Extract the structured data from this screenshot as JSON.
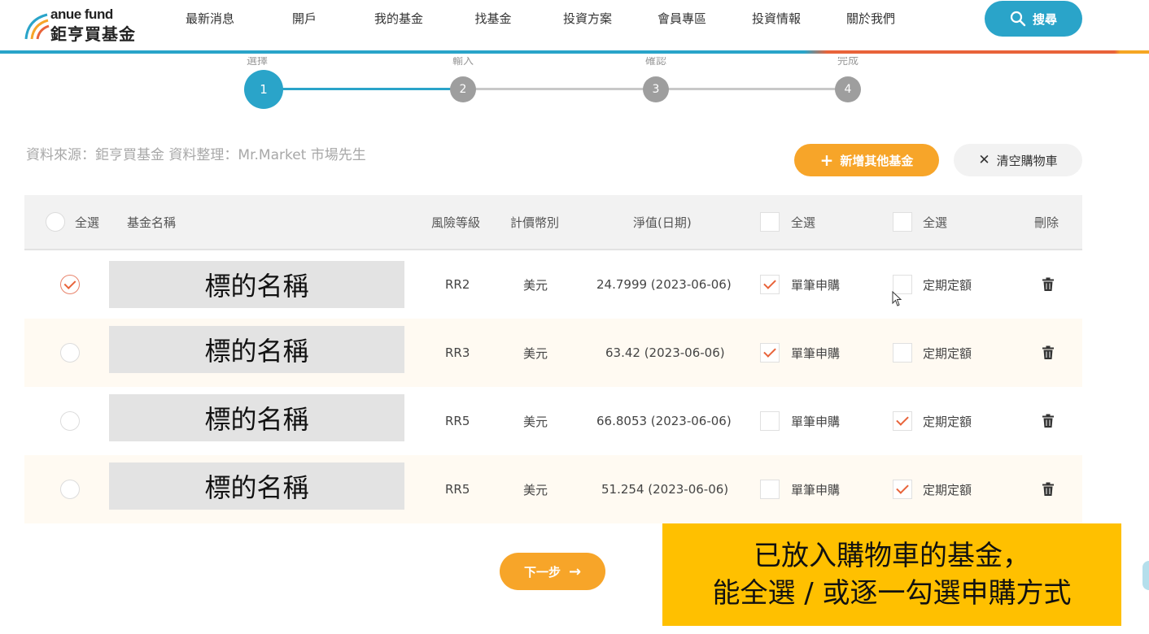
{
  "header": {
    "logo_top": "anue fund",
    "logo_bottom": "鉅亨買基金",
    "nav": [
      "最新消息",
      "開戶",
      "我的基金",
      "找基金",
      "投資方案",
      "會員專區",
      "投資情報",
      "關於我們"
    ],
    "search_label": "搜尋"
  },
  "stepper": {
    "labels": [
      "選擇",
      "輸入",
      "確認",
      "完成"
    ],
    "numbers": [
      "1",
      "2",
      "3",
      "4"
    ],
    "active_step": 1
  },
  "source_note": "資料來源：鉅亨買基金  資料整理：Mr.Market 市場先生",
  "actions": {
    "add_label": "新增其他基金",
    "clear_label": "清空購物車"
  },
  "table": {
    "headers": {
      "select_all": "全選",
      "name": "基金名稱",
      "risk": "風險等級",
      "currency": "計價幣別",
      "nav": "淨值(日期)",
      "single_all": "全選",
      "regular_all": "全選",
      "delete": "刪除"
    },
    "rows": [
      {
        "selected": true,
        "name": "標的名稱",
        "risk": "RR2",
        "currency": "美元",
        "nav": "24.7999 (2023-06-06)",
        "single": true,
        "single_label": "單筆申購",
        "regular": false,
        "regular_label": "定期定額"
      },
      {
        "selected": false,
        "name": "標的名稱",
        "risk": "RR3",
        "currency": "美元",
        "nav": "63.42 (2023-06-06)",
        "single": true,
        "single_label": "單筆申購",
        "regular": false,
        "regular_label": "定期定額"
      },
      {
        "selected": false,
        "name": "標的名稱",
        "risk": "RR5",
        "currency": "美元",
        "nav": "66.8053 (2023-06-06)",
        "single": false,
        "single_label": "單筆申購",
        "regular": true,
        "regular_label": "定期定額"
      },
      {
        "selected": false,
        "name": "標的名稱",
        "risk": "RR5",
        "currency": "美元",
        "nav": "51.254 (2023-06-06)",
        "single": false,
        "single_label": "單筆申購",
        "regular": true,
        "regular_label": "定期定額"
      }
    ]
  },
  "next_label": "下一步",
  "callout": {
    "line1": "已放入購物車的基金，",
    "line2": "能全選 / 或逐一勾選申購方式"
  },
  "colors": {
    "primary": "#2aa4c9",
    "accent": "#f7a529",
    "check": "#e8633a",
    "callout": "#ffc000"
  }
}
